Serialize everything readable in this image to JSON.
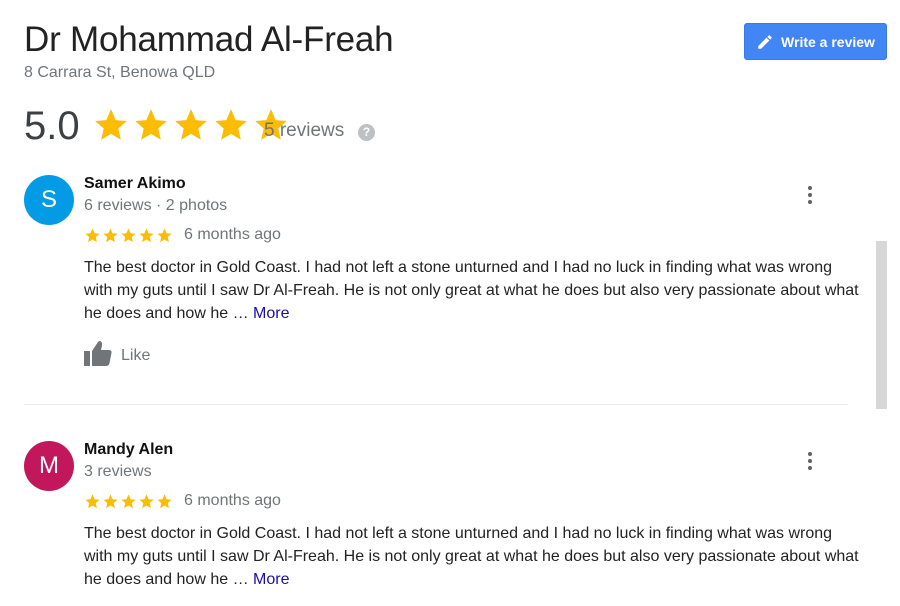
{
  "header": {
    "title": "Dr Mohammad Al-Freah",
    "address": "8 Carrara St, Benowa QLD",
    "write_review_label": "Write a review"
  },
  "rating": {
    "value": "5.0",
    "stars": 5,
    "count_label": "5 reviews",
    "help_glyph": "?",
    "star_color": "#fbbc04"
  },
  "reviews": [
    {
      "avatar_letter": "S",
      "avatar_color": "#039be5",
      "name": "Samer Akimo",
      "meta": "6 reviews · 2 photos",
      "stars": 5,
      "time": "6 months ago",
      "text": "The best doctor in Gold Coast. I had not left a stone unturned and I had no luck in finding what was wrong with my guts until I saw Dr Al-Freah. He is not only great at what he does but also very passionate about what he does and how he … ",
      "more_label": "More",
      "like_label": "Like"
    },
    {
      "avatar_letter": "M",
      "avatar_color": "#c2185b",
      "name": "Mandy Alen",
      "meta": "3 reviews",
      "stars": 5,
      "time": "6 months ago",
      "text": "The best doctor in Gold Coast. I had not left a stone unturned and I had no luck in finding what was wrong with my guts until I saw Dr Al-Freah. He is not only great at what he does but also very passionate about what he does and how he … ",
      "more_label": "More"
    }
  ],
  "colors": {
    "accent": "#4285f4",
    "link": "#1a0dab",
    "muted": "#70757a"
  },
  "icons": [
    "pencil-icon",
    "star-icon",
    "help-icon",
    "more-vert-icon",
    "thumb-up-icon"
  ]
}
